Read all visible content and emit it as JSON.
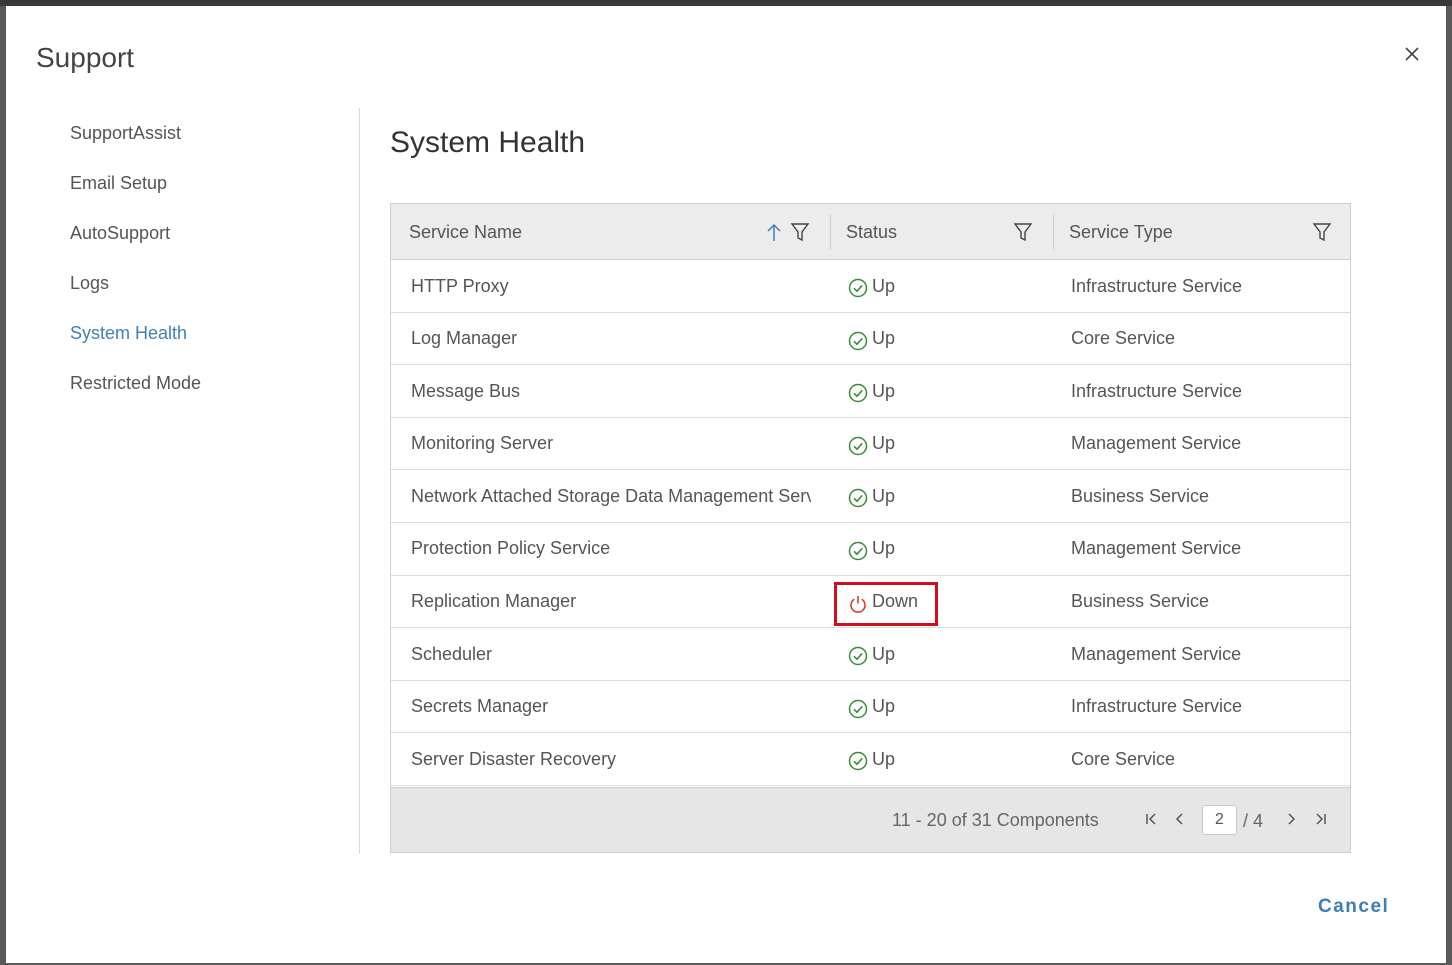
{
  "modal": {
    "title": "Support",
    "cancel_label": "Cancel"
  },
  "sidebar": {
    "items": [
      {
        "label": "SupportAssist",
        "active": false
      },
      {
        "label": "Email Setup",
        "active": false
      },
      {
        "label": "AutoSupport",
        "active": false
      },
      {
        "label": "Logs",
        "active": false
      },
      {
        "label": "System Health",
        "active": true
      },
      {
        "label": "Restricted Mode",
        "active": false
      }
    ]
  },
  "page": {
    "title": "System Health"
  },
  "table": {
    "columns": [
      "Service Name",
      "Status",
      "Service Type"
    ],
    "sort": {
      "column": "Service Name",
      "direction": "ascending"
    },
    "rows": [
      {
        "name": "HTTP Proxy",
        "status": "Up",
        "type": "Infrastructure Service"
      },
      {
        "name": "Log Manager",
        "status": "Up",
        "type": "Core Service"
      },
      {
        "name": "Message Bus",
        "status": "Up",
        "type": "Infrastructure Service"
      },
      {
        "name": "Monitoring Server",
        "status": "Up",
        "type": "Management Service"
      },
      {
        "name": "Network Attached Storage Data Management Serv…",
        "status": "Up",
        "type": "Business Service"
      },
      {
        "name": "Protection Policy Service",
        "status": "Up",
        "type": "Management Service"
      },
      {
        "name": "Replication Manager",
        "status": "Down",
        "type": "Business Service"
      },
      {
        "name": "Scheduler",
        "status": "Up",
        "type": "Management Service"
      },
      {
        "name": "Secrets Manager",
        "status": "Up",
        "type": "Infrastructure Service"
      },
      {
        "name": "Server Disaster Recovery",
        "status": "Up",
        "type": "Core Service"
      }
    ],
    "pagination": {
      "summary": "11 - 20 of 31 Components",
      "current_page": "2",
      "total_pages": "/ 4"
    }
  },
  "colors": {
    "accent": "#3f80b7",
    "up": "#3a8a3a",
    "down": "#d9342b",
    "highlight": "#d00f1e"
  },
  "icons": [
    "close-icon",
    "sort-ascending-icon",
    "filter-icon",
    "check-circle-icon",
    "power-icon",
    "first-page-icon",
    "prev-page-icon",
    "next-page-icon",
    "last-page-icon"
  ]
}
